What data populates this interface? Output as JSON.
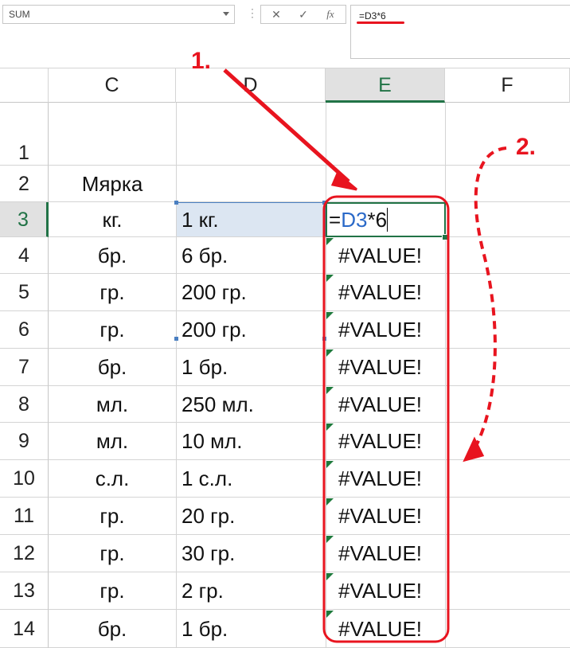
{
  "formula_bar": {
    "name_box": "SUM",
    "cancel_icon": "✕",
    "enter_icon": "✓",
    "fx_icon": "fx",
    "formula": "=D3*6"
  },
  "columns": [
    "C",
    "D",
    "E",
    "F"
  ],
  "rows": [
    {
      "num": "1",
      "c": "",
      "d": "",
      "e": ""
    },
    {
      "num": "2",
      "c": "Мярка",
      "d": "",
      "e": ""
    },
    {
      "num": "3",
      "c": "кг.",
      "d": "1 кг.",
      "e": ""
    },
    {
      "num": "4",
      "c": "бр.",
      "d": "6 бр.",
      "e": "#VALUE!"
    },
    {
      "num": "5",
      "c": "гр.",
      "d": "200 гр.",
      "e": "#VALUE!"
    },
    {
      "num": "6",
      "c": "гр.",
      "d": "200 гр.",
      "e": "#VALUE!"
    },
    {
      "num": "7",
      "c": "бр.",
      "d": "1 бр.",
      "e": "#VALUE!"
    },
    {
      "num": "8",
      "c": "мл.",
      "d": "250 мл.",
      "e": "#VALUE!"
    },
    {
      "num": "9",
      "c": "мл.",
      "d": "10 мл.",
      "e": "#VALUE!"
    },
    {
      "num": "10",
      "c": "с.л.",
      "d": "1 с.л.",
      "e": "#VALUE!"
    },
    {
      "num": "11",
      "c": "гр.",
      "d": "20 гр.",
      "e": "#VALUE!"
    },
    {
      "num": "12",
      "c": "гр.",
      "d": "30 гр.",
      "e": "#VALUE!"
    },
    {
      "num": "13",
      "c": "гр.",
      "d": "2 гр.",
      "e": "#VALUE!"
    },
    {
      "num": "14",
      "c": "бр.",
      "d": "1 бр.",
      "e": "#VALUE!"
    }
  ],
  "edit_cell": {
    "equals": "=",
    "ref": "D3",
    "op": "*",
    "num": "6"
  },
  "annotations": {
    "step1": "1.",
    "step2": "2."
  },
  "colors": {
    "excel_green": "#217346",
    "annotation_red": "#e8141f",
    "reference_blue": "#2a69c8"
  }
}
